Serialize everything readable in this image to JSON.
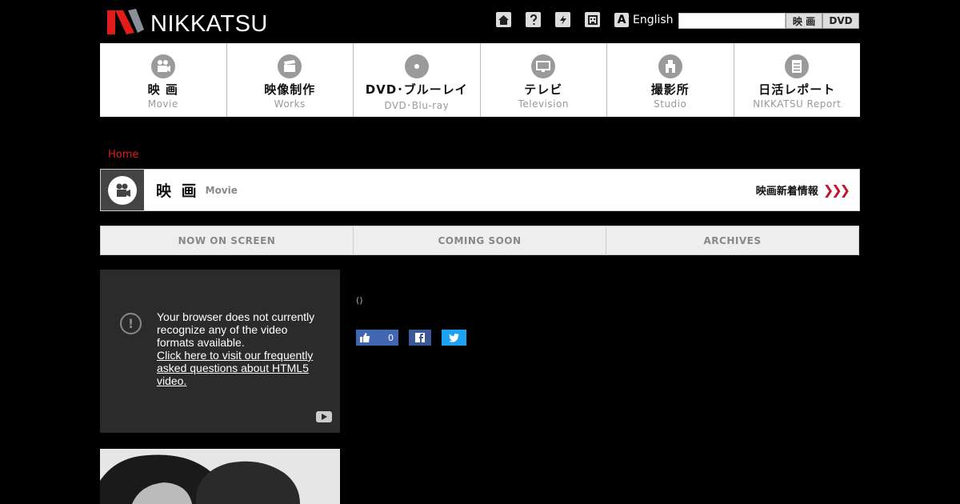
{
  "header": {
    "logo_text": "NIKKATSU",
    "util_icons": [
      "home-icon",
      "help-icon",
      "bolt-icon",
      "mascot-icon"
    ],
    "language_label": "English",
    "language_glyph": "A",
    "search": {
      "placeholder": "",
      "value": "",
      "movie_button": "映 画",
      "dvd_button": "DVD"
    }
  },
  "nav": [
    {
      "jp": "映 画",
      "en": "Movie",
      "icon": "film-camera-icon"
    },
    {
      "jp": "映像制作",
      "en": "Works",
      "icon": "clapperboard-icon"
    },
    {
      "jp": "DVD･ブルーレイ",
      "en": "DVD･Blu-ray",
      "icon": "disc-icon"
    },
    {
      "jp": "テレビ",
      "en": "Television",
      "icon": "tv-icon"
    },
    {
      "jp": "撮影所",
      "en": "Studio",
      "icon": "studio-building-icon"
    },
    {
      "jp": "日活レポート",
      "en": "NIKKATSU Report",
      "icon": "document-icon"
    }
  ],
  "breadcrumb": {
    "home": "Home"
  },
  "section": {
    "title_jp": "映 画",
    "title_en": "Movie",
    "news_link": "映画新着情報",
    "arrows": "❯❯❯"
  },
  "tabs": [
    "NOW ON SCREEN",
    "COMING SOON",
    "ARCHIVES"
  ],
  "video": {
    "warn_glyph": "!",
    "message": "Your browser does not currently recognize any of the video formats available.",
    "link": "Click here to visit our frequently asked questions about HTML5 video."
  },
  "detail": {
    "paren": "()"
  },
  "social": {
    "like_count": "0"
  },
  "colors": {
    "accent_red": "#e21b1b",
    "fb_blue": "#4267b2",
    "twitter_blue": "#1da1f2"
  }
}
